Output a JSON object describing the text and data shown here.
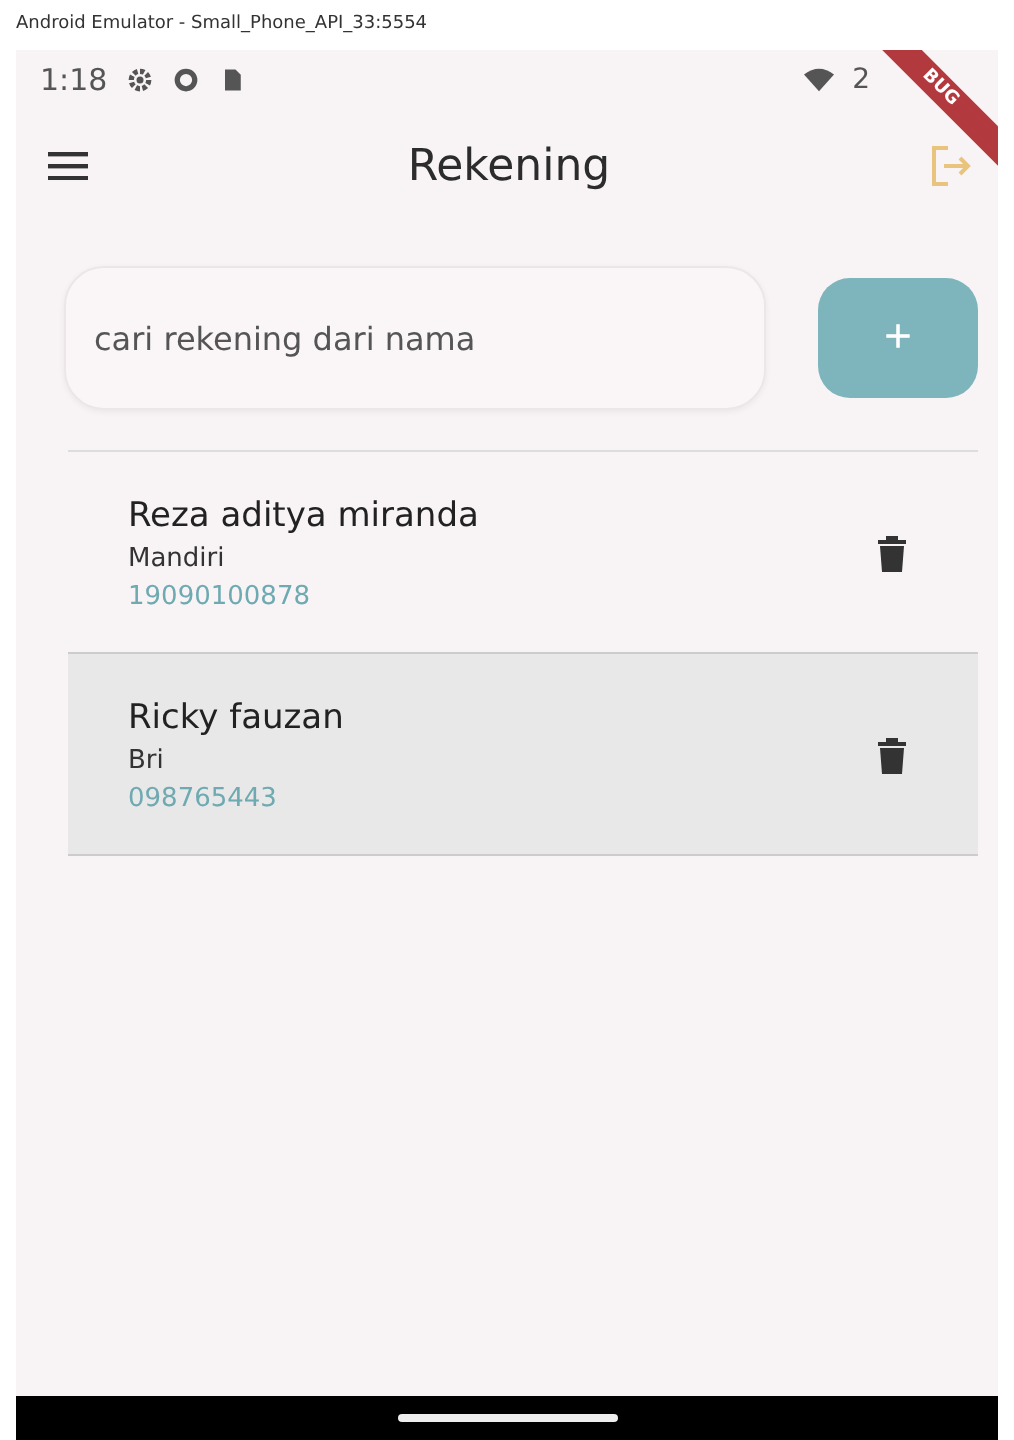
{
  "window": {
    "title": "Android Emulator - Small_Phone_API_33:5554"
  },
  "status_bar": {
    "time": "1:18",
    "signal_text": "2"
  },
  "debug_banner": {
    "label": "BUG"
  },
  "app_bar": {
    "title": "Rekening"
  },
  "search": {
    "placeholder": "cari rekening dari nama"
  },
  "add_button": {
    "label": "+"
  },
  "accounts": [
    {
      "name": "Reza aditya miranda",
      "bank": "Mandiri",
      "number": "19090100878",
      "selected": false
    },
    {
      "name": "Ricky fauzan",
      "bank": "Bri",
      "number": "098765443",
      "selected": true
    }
  ]
}
